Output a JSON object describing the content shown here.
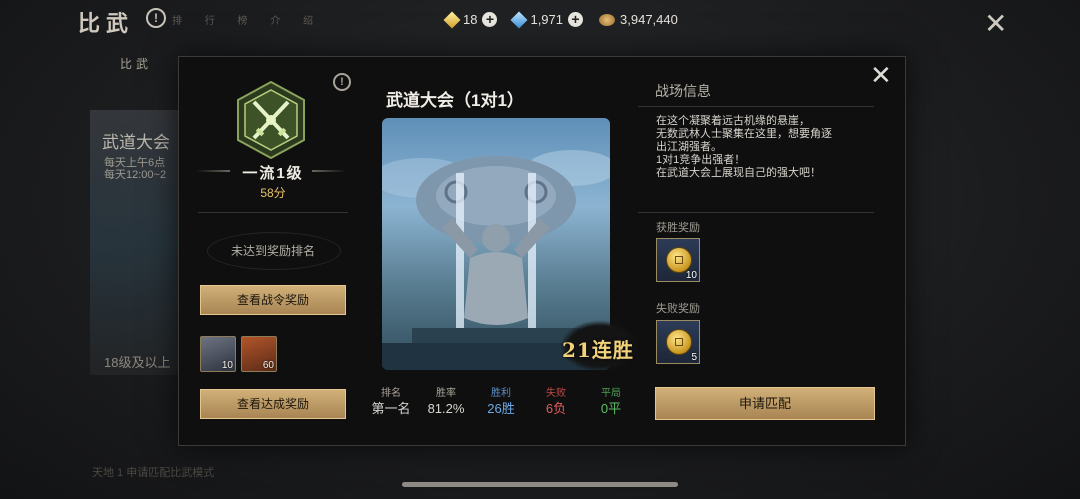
{
  "top": {
    "page_title": "比武",
    "help_label": "!",
    "faded_tabs": "排 行 榜 介 绍",
    "tab_main": "比武",
    "close_glyph": "✕",
    "currencies": [
      {
        "icon": "gold-gem-icon",
        "value": "18",
        "plus": "+"
      },
      {
        "icon": "blue-gem-icon",
        "value": "1,971",
        "plus": "+"
      },
      {
        "icon": "coin-pile-icon",
        "value": "3,947,440"
      }
    ]
  },
  "background_card": {
    "title": "武道大会",
    "line1": "每天上午6点",
    "line2": "每天12:00~2",
    "footer": "18级及以上",
    "bottom_note": "天地 1 申请匹配比武模式"
  },
  "modal": {
    "close_glyph": "✕",
    "help_label": "!",
    "rank": {
      "name": "一流1级",
      "score": "58分",
      "not_ranked": "未达到奖励排名"
    },
    "btn_pass_rewards": "查看战令奖励",
    "items": [
      {
        "icon": "book-icon",
        "count": "10"
      },
      {
        "icon": "pouch-icon",
        "count": "60"
      }
    ],
    "btn_achievement_rewards": "查看达成奖励",
    "mode_title": "武道大会（1对1）",
    "streak": "21连胜",
    "stats": [
      {
        "label": "排名",
        "value": "第一名",
        "color": "#d9d6cf",
        "label_color": "#a8a397"
      },
      {
        "label": "胜率",
        "value": "81.2%",
        "color": "#d9d6cf",
        "label_color": "#a8a397"
      },
      {
        "label": "胜利",
        "value": "26胜",
        "color": "#6fa8e6",
        "label_color": "#5d90c8"
      },
      {
        "label": "失败",
        "value": "6负",
        "color": "#e45a5a",
        "label_color": "#c04848"
      },
      {
        "label": "平局",
        "value": "0平",
        "color": "#5fbf63",
        "label_color": "#4c9f50"
      }
    ],
    "info_title": "战场信息",
    "info_lines": [
      "在这个凝聚着远古机缘的悬崖，",
      "无数武林人士聚集在这里，想要角逐",
      "出江湖强者。",
      "1对1竞争出强者！",
      "在武道大会上展现自己的强大吧！"
    ],
    "win_reward_label": "获胜奖励",
    "win_reward_count": "10",
    "lose_reward_label": "失败奖励",
    "lose_reward_count": "5",
    "btn_match": "申请匹配"
  }
}
